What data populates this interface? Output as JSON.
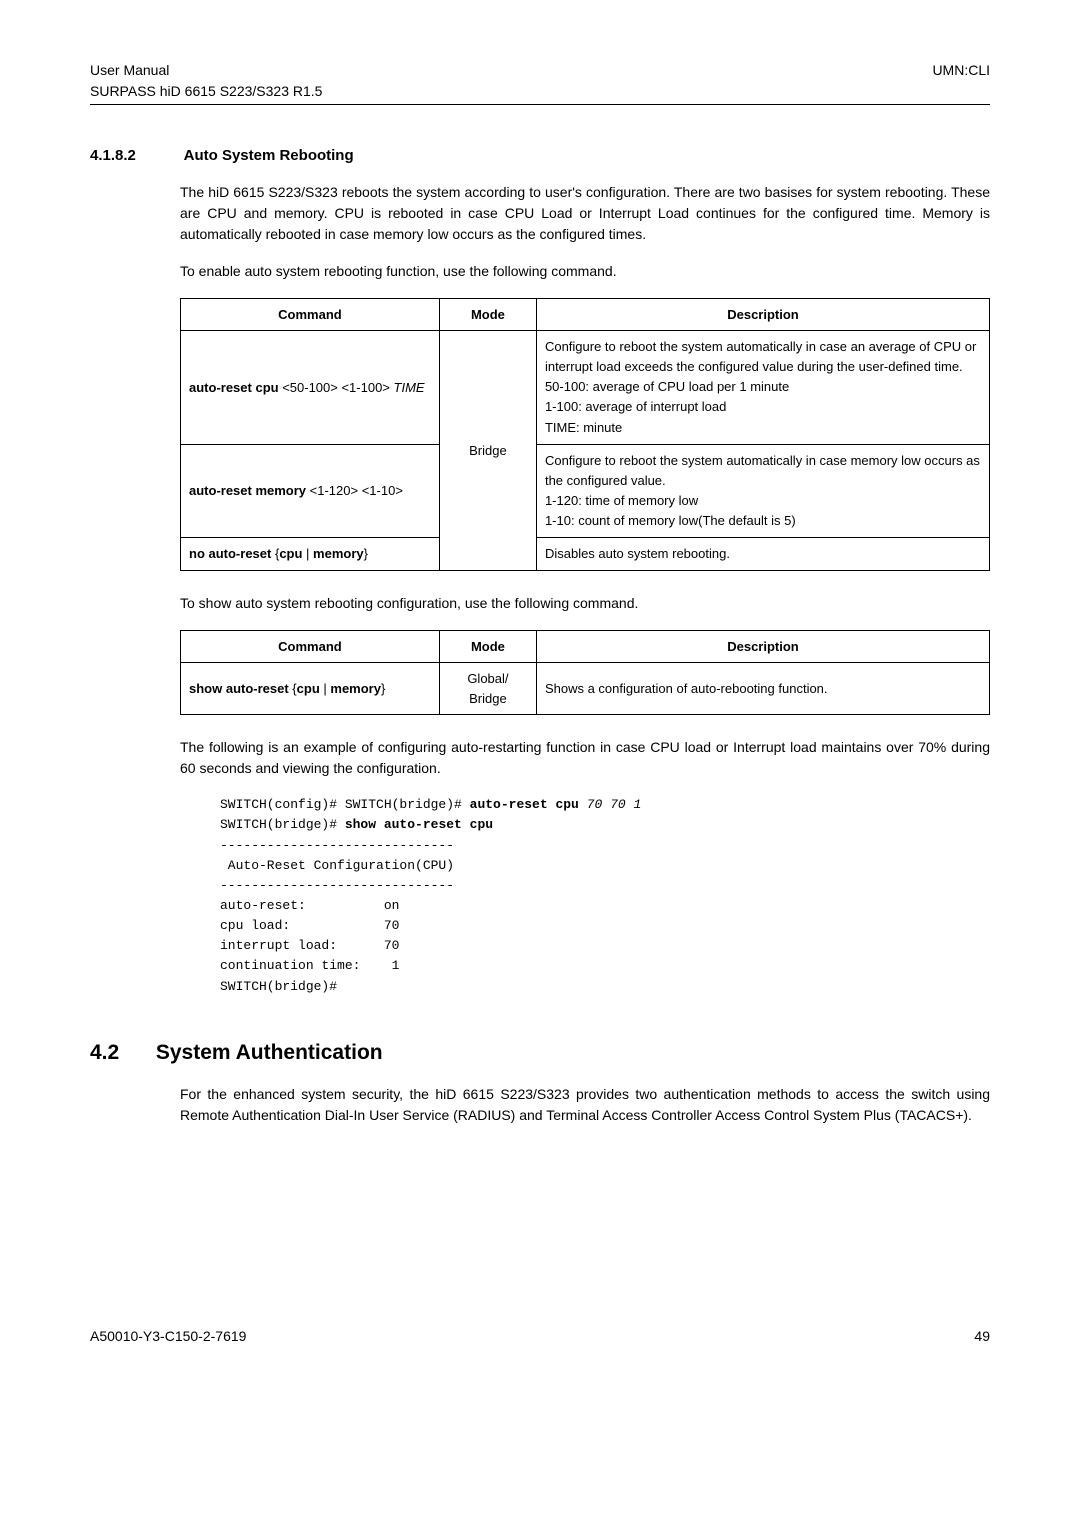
{
  "header": {
    "left1": "User Manual",
    "left2": "SURPASS hiD 6615 S223/S323 R1.5",
    "right": "UMN:CLI"
  },
  "section1": {
    "num": "4.1.8.2",
    "title": "Auto System Rebooting",
    "para1": "The hiD 6615 S223/S323 reboots the system according to user's configuration. There are two basises for system rebooting. These are CPU and memory. CPU is rebooted in case CPU Load or Interrupt Load continues for the configured time. Memory is automatically rebooted in case memory low occurs as the configured times.",
    "para2": "To enable auto system rebooting function, use the following command.",
    "para3": "To show auto system rebooting configuration, use the following command.",
    "para4": "The following is an example of configuring auto-restarting function in case CPU load or Interrupt load maintains over 70% during 60 seconds and viewing the configuration."
  },
  "table_headers": {
    "command": "Command",
    "mode": "Mode",
    "description": "Description"
  },
  "table1": {
    "mode": "Bridge",
    "r1": {
      "cmd_bold": "auto-reset cpu",
      "cmd_plain": " <50-100> <1-100> ",
      "cmd_ital": "TIME",
      "d1": "Configure to reboot the system automatically in case an average of CPU or interrupt load exceeds the configured value during the user-defined time.",
      "d2": "50-100: average of CPU load per 1 minute",
      "d3": "1-100: average of interrupt load",
      "d4": "TIME: minute"
    },
    "r2": {
      "cmd_bold": "auto-reset memory",
      "cmd_plain": " <1-120> <1-10>",
      "d1": "Configure to reboot the system automatically in case memory low occurs as the configured value.",
      "d2": "1-120: time of memory low",
      "d3": "1-10: count of memory low(The default is 5)"
    },
    "r3": {
      "cmd_bold1": "no auto-reset",
      "cmd_plain1": " {",
      "cmd_bold2": "cpu",
      "cmd_plain2": " | ",
      "cmd_bold3": "memory",
      "cmd_plain3": "}",
      "desc": "Disables auto system rebooting."
    }
  },
  "table2": {
    "r1": {
      "cmd_bold1": "show auto-reset",
      "cmd_plain1": " {",
      "cmd_bold2": "cpu",
      "cmd_plain2": " | ",
      "cmd_bold3": "memory",
      "cmd_plain3": "}",
      "mode": "Global/\nBridge",
      "desc": "Shows a configuration of auto-rebooting function."
    }
  },
  "code": {
    "l1a": "SWITCH(config)# SWITCH(bridge)# ",
    "l1b": "auto-reset cpu",
    "l1c": " 70 70 1",
    "l2a": "SWITCH(bridge)# ",
    "l2b": "show auto-reset cpu",
    "l3": "------------------------------",
    "l4": " Auto-Reset Configuration(CPU)",
    "l5": "------------------------------",
    "l6": "auto-reset:          on",
    "l7": "cpu load:            70",
    "l8": "interrupt load:      70",
    "l9": "continuation time:    1",
    "l10": "SWITCH(bridge)#"
  },
  "section2": {
    "num": "4.2",
    "title": "System Authentication",
    "para1": "For the enhanced system security, the hiD 6615 S223/S323 provides two authentication methods to access the switch using Remote Authentication Dial-In User Service (RADIUS) and Terminal Access Controller Access Control System Plus (TACACS+)."
  },
  "footer": {
    "left": "A50010-Y3-C150-2-7619",
    "right": "49"
  }
}
